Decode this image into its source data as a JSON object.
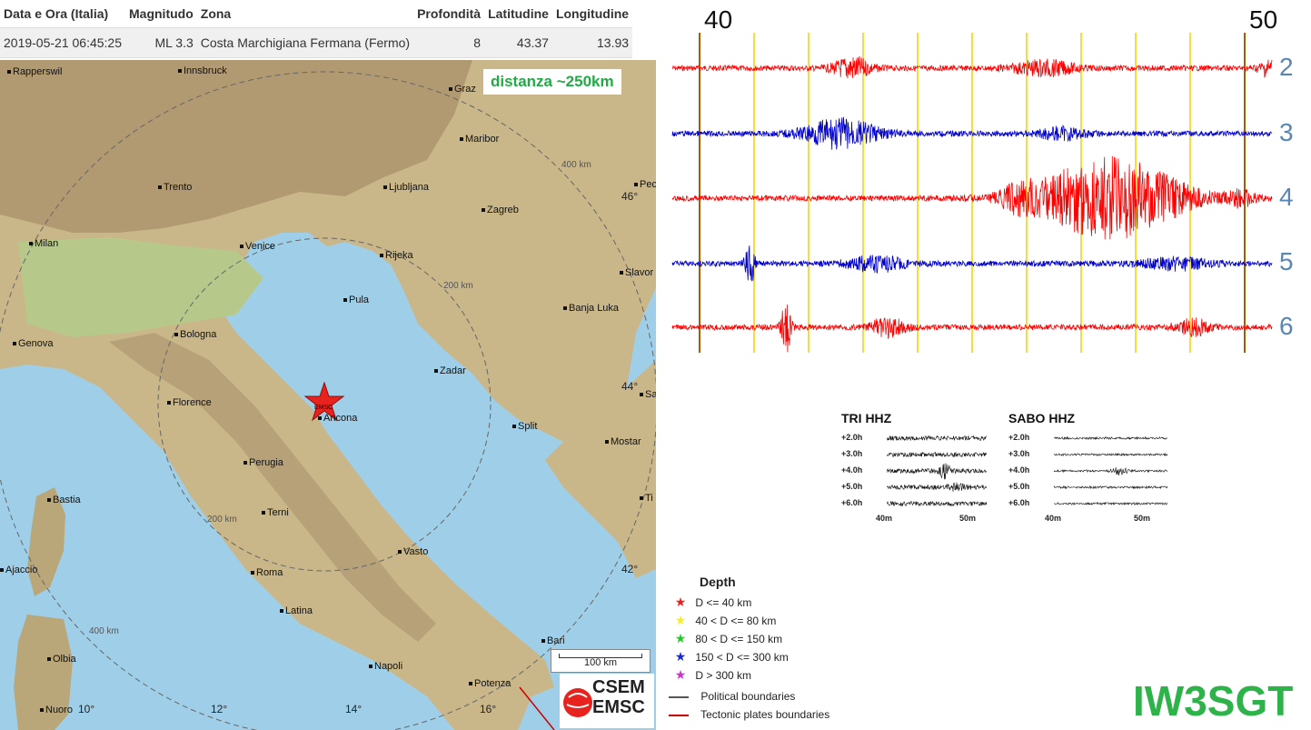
{
  "table": {
    "headers": [
      "Data e Ora (Italia)",
      "Magnitudo",
      "Zona",
      "Profondità",
      "Latitudine",
      "Longitudine"
    ],
    "row": [
      "2019-05-21 06:45:25",
      "ML 3.3",
      "Costa Marchigiana Fermana (Fermo)",
      "8",
      "43.37",
      "13.93"
    ]
  },
  "map": {
    "distance_label": "distanza ~250km",
    "epicenter_label": "EMSC",
    "scale_label": "100 km",
    "ring_labels": [
      "400 km",
      "200 km",
      "200 km",
      "400 km"
    ],
    "cities": [
      "Rapperswil",
      "Innsbruck",
      "Graz",
      "Maribor",
      "Trento",
      "Ljubljana",
      "Zagreb",
      "Pec",
      "Milan",
      "Venice",
      "Rijeka",
      "Slavor",
      "Pula",
      "Banja Luka",
      "Genova",
      "Bologna",
      "Zadar",
      "Florence",
      "Ancona",
      "Split",
      "Sa",
      "Mostar",
      "Perugia",
      "Bastia",
      "Terni",
      "Ti",
      "Vasto",
      "Ajaccio",
      "Roma",
      "Latina",
      "Bari",
      "Olbia",
      "Napoli",
      "Nuoro",
      "Potenza"
    ],
    "lon_labels": [
      "10°",
      "12°",
      "14°",
      "16°"
    ],
    "lat_labels": [
      "46°",
      "44°",
      "42°"
    ]
  },
  "seismogram": {
    "time_start": "40",
    "time_end": "50",
    "trace_numbers": [
      "2",
      "3",
      "4",
      "5",
      "6"
    ],
    "trace_colors": [
      "#ff0000",
      "#0000cc",
      "#ff0000",
      "#0000cc",
      "#ff0000"
    ]
  },
  "helicorders": [
    {
      "title": "TRI HHZ",
      "rows": [
        "+2.0h",
        "+3.0h",
        "+4.0h",
        "+5.0h",
        "+6.0h"
      ],
      "x_start": "40m",
      "x_end": "50m"
    },
    {
      "title": "SABO HHZ",
      "rows": [
        "+2.0h",
        "+3.0h",
        "+4.0h",
        "+5.0h",
        "+6.0h"
      ],
      "x_start": "40m",
      "x_end": "50m"
    }
  ],
  "legend": {
    "title": "Depth",
    "items": [
      {
        "label": "D <= 40 km",
        "color": "#e8231e"
      },
      {
        "label": "40 < D <= 80 km",
        "color": "#f4ee2c"
      },
      {
        "label": "80 < D <= 150 km",
        "color": "#22cc22"
      },
      {
        "label": "150 < D <= 300 km",
        "color": "#1a2bd6"
      },
      {
        "label": "D > 300 km",
        "color": "#cc33cc"
      }
    ],
    "lines": [
      {
        "label": "Political boundaries",
        "color": "#555555"
      },
      {
        "label": "Tectonic plates boundaries",
        "color": "#cc0000"
      }
    ]
  },
  "logo": {
    "line1": "CSEM",
    "line2": "EMSC"
  },
  "callsign": "IW3SGT"
}
